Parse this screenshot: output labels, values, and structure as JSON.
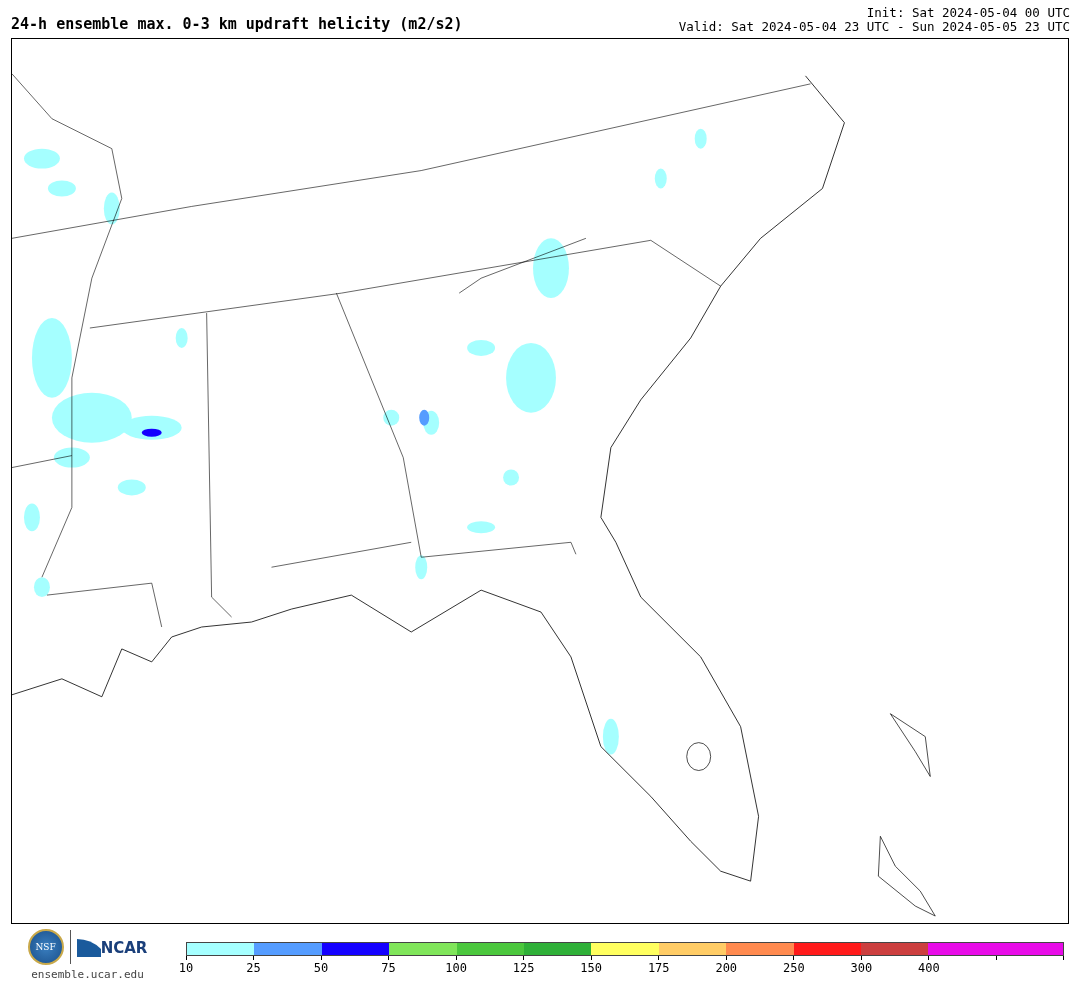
{
  "title": "24-h ensemble max. 0-3 km updraft helicity (m2/s2)",
  "init": "Init: Sat 2024-05-04 00 UTC",
  "valid": "Valid: Sat 2024-05-04 23 UTC - Sun 2024-05-05 23 UTC",
  "footer": {
    "seal_text": "NSF",
    "logo_text": "NCAR",
    "site": "ensemble.ucar.edu"
  },
  "colorbar": {
    "segments": [
      {
        "color": "#a5ffff",
        "tick": "10"
      },
      {
        "color": "#559cff",
        "tick": "25"
      },
      {
        "color": "#1400ff",
        "tick": "50"
      },
      {
        "color": "#80e55a",
        "tick": "75"
      },
      {
        "color": "#4bc73d",
        "tick": "100"
      },
      {
        "color": "#2fb038",
        "tick": "125"
      },
      {
        "color": "#ffff5f",
        "tick": "150"
      },
      {
        "color": "#ffcc66",
        "tick": "175"
      },
      {
        "color": "#ff8a4f",
        "tick": "200"
      },
      {
        "color": "#ff1a1a",
        "tick": "250"
      },
      {
        "color": "#cc3f3f",
        "tick": "300"
      },
      {
        "color": "#e80be8",
        "tick": "400"
      },
      {
        "color": "#e80be8"
      }
    ]
  }
}
